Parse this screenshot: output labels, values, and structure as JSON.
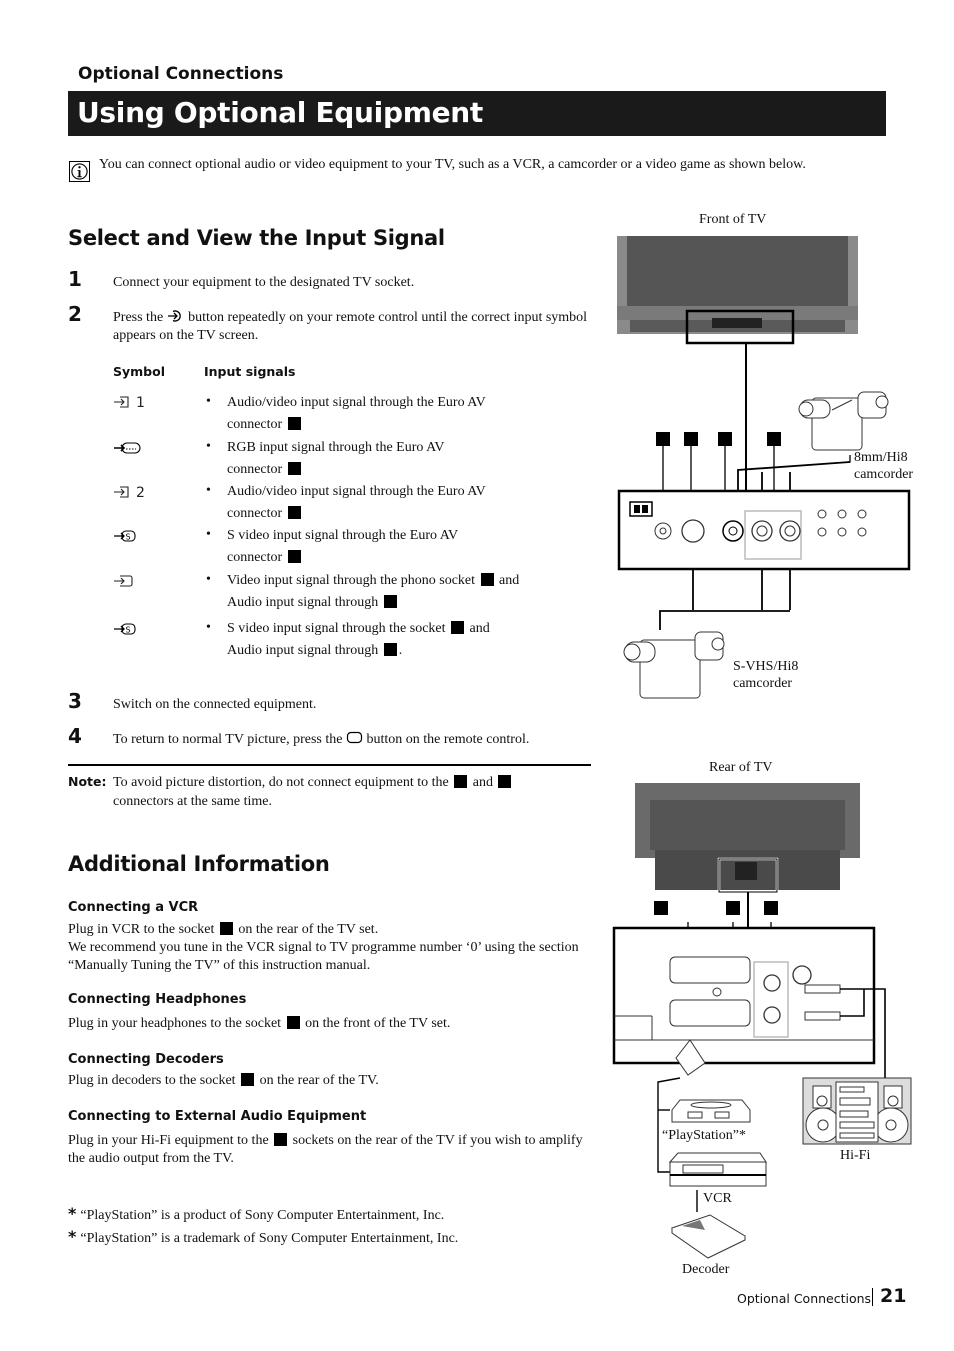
{
  "header": {
    "section": "Optional Connections",
    "title": "Using Optional Equipment"
  },
  "intro": {
    "icon": "info-icon",
    "text": "You can connect optional audio or video equipment to your TV, such as a VCR, a camcorder or a video game as shown below."
  },
  "select_view": {
    "heading": "Select and View the Input Signal",
    "steps": [
      {
        "num": "1",
        "text": "Connect your equipment to the designated TV socket."
      },
      {
        "num": "2",
        "text_before": "Press the",
        "icon": "input-select-icon",
        "text_after": "button repeatedly on your remote control until the correct input symbol appears on the TV screen."
      },
      {
        "num": "3",
        "text": "Switch on the connected equipment."
      },
      {
        "num": "4",
        "text_before": "To return to normal TV picture, press the",
        "icon": "tv-screen-icon",
        "text_after": "button on the remote control."
      }
    ],
    "table": {
      "col_symbol": "Symbol",
      "col_signals": "Input signals",
      "rows": [
        {
          "symbol": "⇥1",
          "symbol_icon": "av1-input-icon",
          "line1": "Audio/video input signal through the Euro AV",
          "line2": "connector"
        },
        {
          "symbol": "⇥RGB",
          "symbol_icon": "rgb-input-icon",
          "line1": "RGB input signal through the Euro AV",
          "line2": "connector"
        },
        {
          "symbol": "⇥2",
          "symbol_icon": "av2-input-icon",
          "line1": "Audio/video input signal through the Euro AV",
          "line2": "connector"
        },
        {
          "symbol": "⇥S",
          "symbol_icon": "svideo-euro-input-icon",
          "line1": "S video input signal through the Euro AV",
          "line2": "connector"
        },
        {
          "symbol": "⇥",
          "symbol_icon": "front-video-input-icon",
          "line1a": "Video input signal through the phono socket",
          "line1b": "and",
          "line2": "Audio input signal through"
        },
        {
          "symbol": "⇥S",
          "symbol_icon": "front-svideo-input-icon",
          "line1a": "S video input signal through the socket",
          "line1b": "and",
          "line2": "Audio input signal through",
          "line2_end": "."
        }
      ]
    },
    "note": {
      "label": "Note:",
      "text_before": "To avoid picture distortion, do not connect equipment to the",
      "text_mid": "and",
      "text_after": "connectors at the same time."
    }
  },
  "additional": {
    "heading": "Additional Information",
    "items": [
      {
        "title": "Connecting a VCR",
        "text_before": "Plug in VCR to the socket",
        "text_after": "on the rear of the TV set.",
        "text_extra": "We recommend you tune in the VCR signal to TV programme number ‘0’ using the section “Manually Tuning the TV” of this instruction manual."
      },
      {
        "title": "Connecting Headphones",
        "text_before": "Plug in your headphones to the socket",
        "text_after": "on the front of the TV set."
      },
      {
        "title": "Connecting Decoders",
        "text_before": "Plug in decoders to the socket",
        "text_after": "on the rear of the TV."
      },
      {
        "title": "Connecting to External Audio Equipment",
        "text_before": "Plug in your Hi-Fi equipment to the",
        "text_after": "sockets on the rear of the TV if you wish to amplify the audio output from the TV."
      }
    ]
  },
  "footnotes": [
    {
      "mark": "*",
      "text": "“PlayStation” is a product of Sony Computer Entertainment, Inc."
    },
    {
      "mark": "*",
      "text": "“PlayStation” is a trademark of Sony Computer Entertainment, Inc."
    }
  ],
  "diagram": {
    "front_caption": "Front of TV",
    "rear_caption": "Rear of TV",
    "camcorder_8mm": "8mm/Hi8 camcorder",
    "camcorder_svhs": "S-VHS/Hi8 camcorder",
    "playstation": "“PlayStation”*",
    "vcr": "VCR",
    "decoder": "Decoder",
    "hifi": "Hi-Fi"
  },
  "footer": {
    "section": "Optional Connections",
    "page": "21"
  }
}
